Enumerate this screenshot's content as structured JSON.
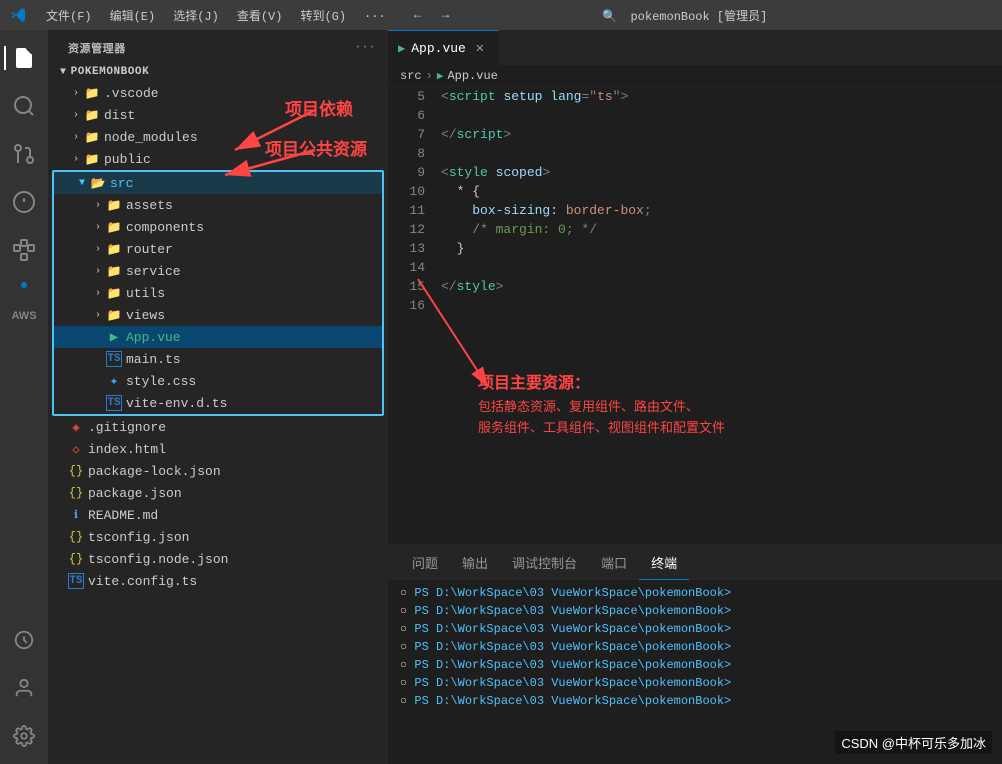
{
  "titleBar": {
    "menus": [
      "文件(F)",
      "编辑(E)",
      "选择(J)",
      "查看(V)",
      "转到(G)",
      "..."
    ],
    "title": "pokemonBook [管理员]",
    "searchPlaceholder": "pokemonBook [管理员]"
  },
  "sidebar": {
    "title": "资源管理器",
    "projectName": "POKEMONBOOK",
    "folders": {
      "root": [
        {
          "name": ".vscode",
          "type": "folder",
          "indent": 1
        },
        {
          "name": "dist",
          "type": "folder",
          "indent": 1
        },
        {
          "name": "node_modules",
          "type": "folder",
          "indent": 1
        },
        {
          "name": "public",
          "type": "folder",
          "indent": 1
        }
      ],
      "src": {
        "name": "src",
        "children": [
          {
            "name": "assets",
            "type": "folder",
            "indent": 2
          },
          {
            "name": "components",
            "type": "folder",
            "indent": 2
          },
          {
            "name": "router",
            "type": "folder",
            "indent": 2
          },
          {
            "name": "service",
            "type": "folder",
            "indent": 2
          },
          {
            "name": "utils",
            "type": "folder",
            "indent": 2
          },
          {
            "name": "views",
            "type": "folder",
            "indent": 2
          }
        ]
      },
      "srcFiles": [
        {
          "name": "App.vue",
          "type": "vue",
          "indent": 2,
          "active": true
        },
        {
          "name": "main.ts",
          "type": "ts",
          "indent": 2
        },
        {
          "name": "style.css",
          "type": "css",
          "indent": 2
        },
        {
          "name": "vite-env.d.ts",
          "type": "ts",
          "indent": 2
        }
      ],
      "rootFiles": [
        {
          "name": ".gitignore",
          "type": "git",
          "indent": 1
        },
        {
          "name": "index.html",
          "type": "html",
          "indent": 1
        },
        {
          "name": "package-lock.json",
          "type": "json",
          "indent": 1
        },
        {
          "name": "package.json",
          "type": "json",
          "indent": 1
        },
        {
          "name": "README.md",
          "type": "md",
          "indent": 1
        },
        {
          "name": "tsconfig.json",
          "type": "json",
          "indent": 1
        },
        {
          "name": "tsconfig.node.json",
          "type": "json",
          "indent": 1
        },
        {
          "name": "vite.config.ts",
          "type": "ts",
          "indent": 1
        }
      ]
    }
  },
  "annotations": {
    "dep": "项目依赖",
    "public": "项目公共资源",
    "src": "项目主要资源：",
    "srcDesc": "包括静态资源、复用组件、路由文件、\n服务组件、工具组件、视图组件和配置文件"
  },
  "editor": {
    "file": "App.vue",
    "breadcrumb": [
      "src",
      "App.vue"
    ],
    "lines": [
      {
        "num": 5,
        "content": [
          {
            "t": "<",
            "c": "punct"
          },
          {
            "t": "script",
            "c": "tag"
          },
          {
            "t": " setup ",
            "c": ""
          },
          {
            "t": "lang",
            "c": "attr"
          },
          {
            "t": "=\"",
            "c": "punct"
          },
          {
            "t": "ts",
            "c": "str"
          },
          {
            "t": "\"",
            "c": "punct"
          },
          {
            "t": ">",
            "c": "punct"
          }
        ]
      },
      {
        "num": 6,
        "content": []
      },
      {
        "num": 7,
        "content": [
          {
            "t": "</",
            "c": "punct"
          },
          {
            "t": "script",
            "c": "tag"
          },
          {
            "t": ">",
            "c": "punct"
          }
        ]
      },
      {
        "num": 8,
        "content": []
      },
      {
        "num": 9,
        "content": [
          {
            "t": "<",
            "c": "punct"
          },
          {
            "t": "style",
            "c": "tag"
          },
          {
            "t": " ",
            "c": ""
          },
          {
            "t": "scoped",
            "c": "attr"
          },
          {
            "t": ">",
            "c": "punct"
          }
        ]
      },
      {
        "num": 10,
        "content": [
          {
            "t": "  * {",
            "c": ""
          }
        ]
      },
      {
        "num": 11,
        "content": [
          {
            "t": "    ",
            "c": ""
          },
          {
            "t": "box-sizing",
            "c": "prop"
          },
          {
            "t": ": ",
            "c": ""
          },
          {
            "t": "border-box",
            "c": "val"
          },
          {
            "t": ";",
            "c": "punct"
          }
        ]
      },
      {
        "num": 12,
        "content": [
          {
            "t": "    ",
            "c": ""
          },
          {
            "t": "/* margin: 0; */",
            "c": "comment"
          }
        ]
      },
      {
        "num": 13,
        "content": [
          {
            "t": "  }",
            "c": ""
          }
        ]
      },
      {
        "num": 14,
        "content": []
      },
      {
        "num": 15,
        "content": [
          {
            "t": "</",
            "c": "punct"
          },
          {
            "t": "style",
            "c": "tag"
          },
          {
            "t": ">",
            "c": "punct"
          }
        ]
      },
      {
        "num": 16,
        "content": []
      }
    ]
  },
  "panels": {
    "tabs": [
      "问题",
      "输出",
      "调试控制台",
      "端口",
      "终端"
    ],
    "activeTab": "终端",
    "terminal": {
      "lines": [
        "PS D:\\WorkSpace\\03 VueWorkSpace\\pokemonBook>",
        "PS D:\\WorkSpace\\03 VueWorkSpace\\pokemonBook>",
        "PS D:\\WorkSpace\\03 VueWorkSpace\\pokemonBook>",
        "PS D:\\WorkSpace\\03 VueWorkSpace\\pokemonBook>",
        "PS D:\\WorkSpace\\03 VueWorkSpace\\pokemonBook>",
        "PS D:\\WorkSpace\\03 VueWorkSpace\\pokemonBook>",
        "PS D:\\WorkSpace\\03 VueWorkSpace\\pokemonBook>"
      ]
    }
  },
  "watermark": "CSDN @中杯可乐多加冰"
}
